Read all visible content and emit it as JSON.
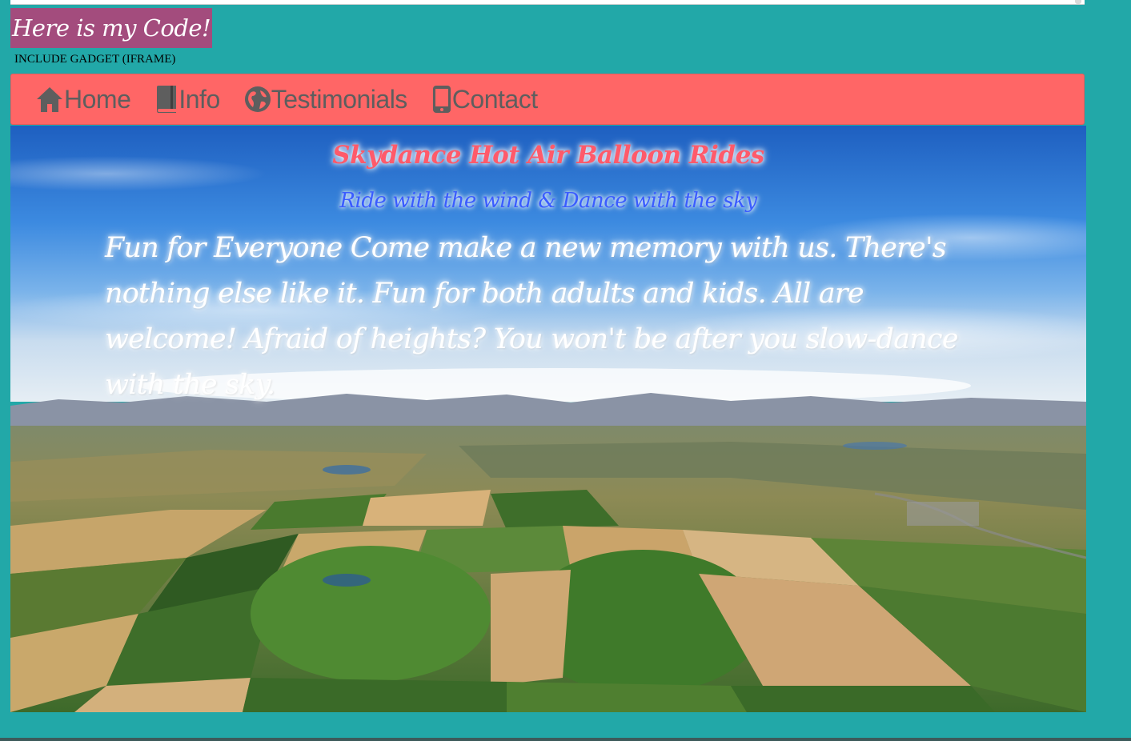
{
  "header": {
    "code_tag": "Here is my Code!",
    "gadget_label": "INCLUDE GADGET (IFRAME)"
  },
  "nav": {
    "items": [
      {
        "label": "Home",
        "icon": "home-icon"
      },
      {
        "label": "Info",
        "icon": "book-icon"
      },
      {
        "label": "Testimonials",
        "icon": "globe-icon"
      },
      {
        "label": "Contact",
        "icon": "phone-icon"
      }
    ]
  },
  "hero": {
    "title": "Skydance Hot Air Balloon Rides",
    "subtitle": "Ride with the wind & Dance with the sky",
    "body": "Fun for Everyone Come make a new memory with us. There's nothing else like it. Fun for both adults and kids. All are welcome! Afraid of heights? You won't be after you slow-dance with the sky."
  },
  "colors": {
    "page_background": "#22a8a8",
    "code_tag_background": "#a34c7d",
    "nav_background": "#ff6666",
    "nav_text": "#5e5e5e",
    "title_color": "#ff5a6a",
    "subtitle_color": "#3a5cff"
  }
}
